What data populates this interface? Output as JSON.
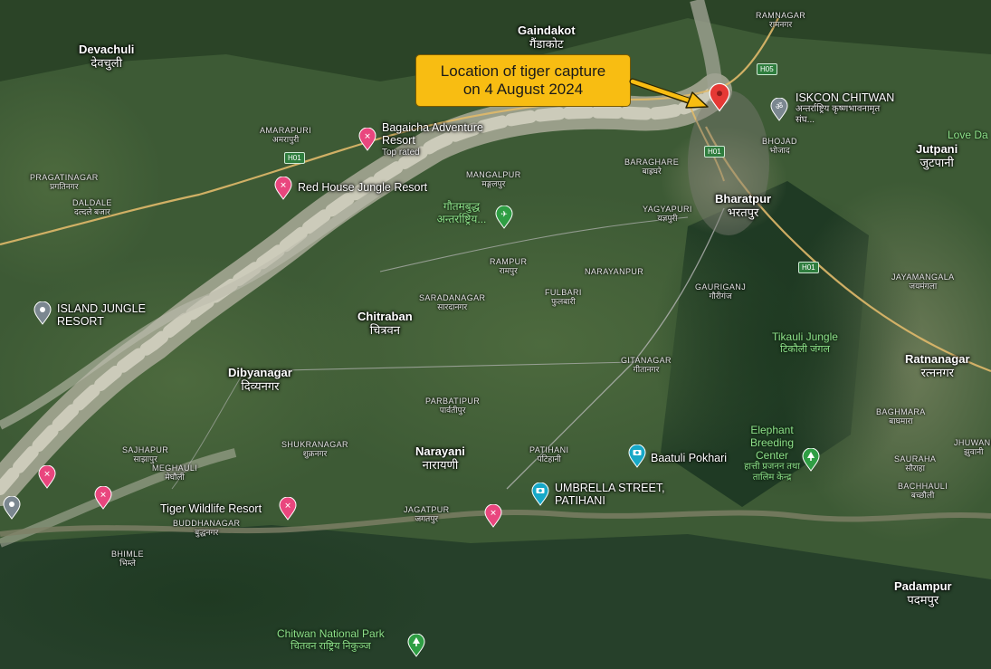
{
  "callout": {
    "line1": "Location of tiger capture",
    "line2": "on 4 August 2024"
  },
  "towns_large": [
    {
      "en": "Gaindakot",
      "np": "गैंडाकोट"
    },
    {
      "en": "Devachuli",
      "np": "देवचुली"
    },
    {
      "en": "Bharatpur",
      "np": "भरतपुर"
    },
    {
      "en": "Chitraban",
      "np": "चित्रवन"
    },
    {
      "en": "Dibyanagar",
      "np": "दिव्यनगर"
    },
    {
      "en": "Narayani",
      "np": "नारायणी"
    },
    {
      "en": "Jutpani",
      "np": "जुटपानी"
    },
    {
      "en": "Ratnanagar",
      "np": "रत्ननगर"
    },
    {
      "en": "Padampur",
      "np": "पदमपुर"
    }
  ],
  "towns_small": [
    {
      "en": "RAMNAGAR",
      "np": "रामनगर"
    },
    {
      "en": "AMARAPURI",
      "np": "अमरापुरी"
    },
    {
      "en": "PRAGATINAGAR",
      "np": "प्रगतिनगर"
    },
    {
      "en": "DALDALE",
      "np": "दल्दले बजार"
    },
    {
      "en": "MANGALPUR",
      "np": "मङ्गलपुर"
    },
    {
      "en": "BARAGHARE",
      "np": "बाह्रघरे"
    },
    {
      "en": "BHOJAD",
      "np": "भोजाद"
    },
    {
      "en": "YAGYAPURI",
      "np": "यज्ञपुरी"
    },
    {
      "en": "RAMPUR",
      "np": "रामपुर"
    },
    {
      "en": "NARAYANPUR",
      "np": ""
    },
    {
      "en": "SARADANAGAR",
      "np": "सारदानगर"
    },
    {
      "en": "FULBARI",
      "np": "फुलबारी"
    },
    {
      "en": "GAURIGANJ",
      "np": "गौरीगंज"
    },
    {
      "en": "JAYAMANGALA",
      "np": "जयमंगला"
    },
    {
      "en": "GITANAGAR",
      "np": "गीतानगर"
    },
    {
      "en": "PARBATIPUR",
      "np": "पार्वतीपुर"
    },
    {
      "en": "SHUKRANAGAR",
      "np": "शुक्रनगर"
    },
    {
      "en": "SAJHAPUR",
      "np": "साझापुर"
    },
    {
      "en": "MEGHAULI",
      "np": "मेघौली"
    },
    {
      "en": "BUDDHANAGAR",
      "np": "बुद्धनगर"
    },
    {
      "en": "PATIHANI",
      "np": "पटिहानी"
    },
    {
      "en": "JAGATPUR",
      "np": "जगतपुर"
    },
    {
      "en": "BHIMLE",
      "np": "भिम्ले"
    },
    {
      "en": "BAGHMARA",
      "np": "बाघमारा"
    },
    {
      "en": "SAURAHA",
      "np": "सौराहा"
    },
    {
      "en": "BACHHAULI",
      "np": "बच्छौली"
    },
    {
      "en": "JHUWANI",
      "np": "झुवानी"
    }
  ],
  "green_labels": [
    {
      "en": "Tikauli Jungle",
      "np": "टिकौली जंगल"
    },
    {
      "en": "Elephant Breeding Center",
      "np": "हात्ती प्रजनन तथा तालिम केन्द्र"
    },
    {
      "en": "Chitwan National Park",
      "np": "चितवन राष्ट्रिय निकुञ्ज"
    },
    {
      "en": "गौतमबुद्ध अन्तर्राष्ट्रिय...",
      "np": ""
    },
    {
      "en": "Love Da",
      "np": ""
    }
  ],
  "pois": [
    {
      "name": "Bagaicha Adventure Resort",
      "sub": "Top rated"
    },
    {
      "name": "Red House Jungle Resort",
      "sub": ""
    },
    {
      "name": "ISLAND JUNGLE RESORT",
      "sub": ""
    },
    {
      "name": "Tiger Wildlife Resort",
      "sub": ""
    },
    {
      "name": "ISKCON CHITWAN",
      "sub": "अन्तर्राष्ट्रिय कृष्णभावनामृत संघ..."
    },
    {
      "name": "Baatuli Pokhari",
      "sub": ""
    },
    {
      "name": "UMBRELLA STREET, PATIHANI",
      "sub": ""
    }
  ],
  "road_badges": [
    "H05",
    "H01",
    "H01",
    "H01"
  ],
  "colors": {
    "callout_bg": "#f8bd12",
    "pin_red": "#e53935",
    "hotel_pin": "#e9467e",
    "attraction_pin": "#17a8c7",
    "park_pin": "#2f9e44",
    "river": "#a7a79a"
  }
}
